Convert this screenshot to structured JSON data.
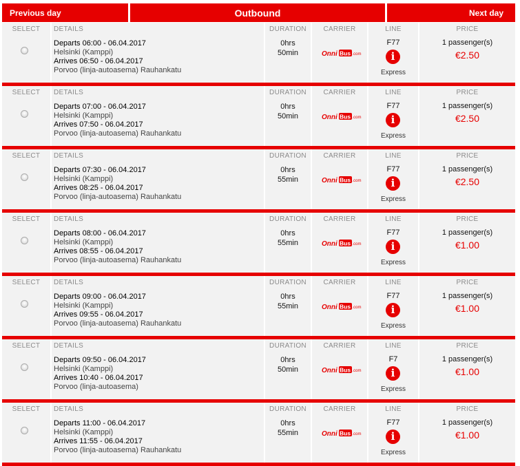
{
  "nav": {
    "previous_label": "Previous day",
    "title": "Outbound",
    "next_label": "Next day"
  },
  "columns": {
    "select": "SELECT",
    "details": "DETAILS",
    "duration": "DURATION",
    "carrier": "CARRIER",
    "line": "LINE",
    "price": "PRICE"
  },
  "carrier_logo": {
    "name": "OnniBus.com",
    "word1": "Onni",
    "word2": "Bus",
    "suffix": ".com",
    "color": "#e60000"
  },
  "info_glyph": "i",
  "accent_color": "#e60000",
  "trips": [
    {
      "depart": "Departs 06:00 - 06.04.2017",
      "from": "Helsinki (Kamppi)",
      "arrive": "Arrives 06:50 - 06.04.2017",
      "to": "Porvoo (linja-autoasema) Rauhankatu",
      "dur_h": "0hrs",
      "dur_m": "50min",
      "line": "F77",
      "line_type": "Express",
      "passengers": "1 passenger(s)",
      "price": "€2.50"
    },
    {
      "depart": "Departs 07:00 - 06.04.2017",
      "from": "Helsinki (Kamppi)",
      "arrive": "Arrives 07:50 - 06.04.2017",
      "to": "Porvoo (linja-autoasema) Rauhankatu",
      "dur_h": "0hrs",
      "dur_m": "50min",
      "line": "F77",
      "line_type": "Express",
      "passengers": "1 passenger(s)",
      "price": "€2.50"
    },
    {
      "depart": "Departs 07:30 - 06.04.2017",
      "from": "Helsinki (Kamppi)",
      "arrive": "Arrives 08:25 - 06.04.2017",
      "to": "Porvoo (linja-autoasema) Rauhankatu",
      "dur_h": "0hrs",
      "dur_m": "55min",
      "line": "F77",
      "line_type": "Express",
      "passengers": "1 passenger(s)",
      "price": "€2.50"
    },
    {
      "depart": "Departs 08:00 - 06.04.2017",
      "from": "Helsinki (Kamppi)",
      "arrive": "Arrives 08:55 - 06.04.2017",
      "to": "Porvoo (linja-autoasema) Rauhankatu",
      "dur_h": "0hrs",
      "dur_m": "55min",
      "line": "F77",
      "line_type": "Express",
      "passengers": "1 passenger(s)",
      "price": "€1.00"
    },
    {
      "depart": "Departs 09:00 - 06.04.2017",
      "from": "Helsinki (Kamppi)",
      "arrive": "Arrives 09:55 - 06.04.2017",
      "to": "Porvoo (linja-autoasema) Rauhankatu",
      "dur_h": "0hrs",
      "dur_m": "55min",
      "line": "F77",
      "line_type": "Express",
      "passengers": "1 passenger(s)",
      "price": "€1.00"
    },
    {
      "depart": "Departs 09:50 - 06.04.2017",
      "from": "Helsinki (Kamppi)",
      "arrive": "Arrives 10:40 - 06.04.2017",
      "to": "Porvoo (linja-autoasema)",
      "dur_h": "0hrs",
      "dur_m": "50min",
      "line": "F7",
      "line_type": "Express",
      "passengers": "1 passenger(s)",
      "price": "€1.00"
    },
    {
      "depart": "Departs 11:00 - 06.04.2017",
      "from": "Helsinki (Kamppi)",
      "arrive": "Arrives 11:55 - 06.04.2017",
      "to": "Porvoo (linja-autoasema) Rauhankatu",
      "dur_h": "0hrs",
      "dur_m": "55min",
      "line": "F77",
      "line_type": "Express",
      "passengers": "1 passenger(s)",
      "price": "€1.00"
    }
  ]
}
